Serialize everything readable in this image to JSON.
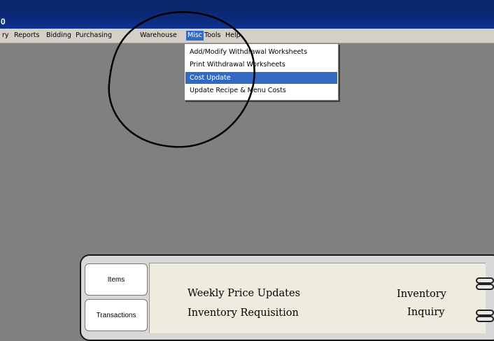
{
  "window": {
    "title": "0"
  },
  "menubar": {
    "items": [
      {
        "label": "ry"
      },
      {
        "label": "Reports"
      },
      {
        "label": "Bidding"
      },
      {
        "label": "Purchasing"
      },
      {
        "label": "Warehouse"
      },
      {
        "label": "Misc"
      },
      {
        "label": "Tools"
      },
      {
        "label": "Help"
      }
    ],
    "open_menu": "Misc"
  },
  "misc_menu": {
    "items": [
      {
        "label": "Add/Modify Withdrawal Worksheets"
      },
      {
        "label": "Print Withdrawal Worksheets"
      },
      {
        "label": "Cost Update"
      },
      {
        "label": "Update Recipe & Menu Costs"
      }
    ],
    "highlighted": "Cost Update"
  },
  "notebook": {
    "tabs": [
      {
        "label": "Items"
      },
      {
        "label": "Transactions"
      }
    ],
    "links": {
      "weekly_price_updates": "Weekly Price Updates",
      "inventory_requisition": "Inventory Requisition",
      "inventory_inquiry_line1": "Inventory",
      "inventory_inquiry_line2": "Inquiry"
    }
  },
  "colors": {
    "title_bar": "#0a246a",
    "menu_bar": "#d4d0c8",
    "highlight": "#316ac5",
    "desktop": "#808080",
    "page": "#efecdf"
  }
}
